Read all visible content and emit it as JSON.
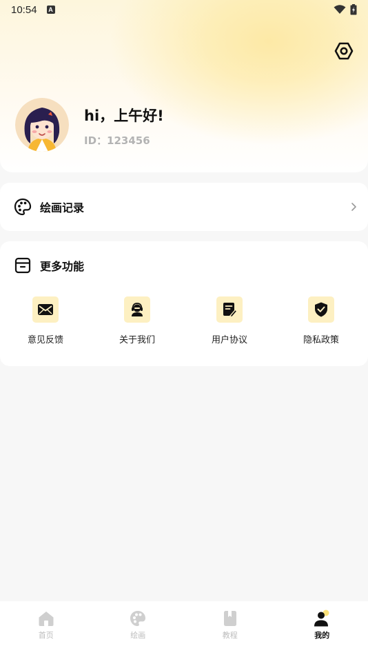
{
  "status_bar": {
    "time": "10:54",
    "notification_icon": "A",
    "icons": [
      "wifi-icon",
      "battery-icon"
    ]
  },
  "header": {
    "settings_icon": "settings-hex-icon",
    "greeting": "hi，上午好!",
    "user_id": "ID：123456"
  },
  "drawing_records": {
    "icon": "palette-icon",
    "label": "绘画记录"
  },
  "more_features": {
    "icon": "box-icon",
    "title": "更多功能",
    "items": [
      {
        "icon": "mail-icon",
        "label": "意见反馈"
      },
      {
        "icon": "support-agent-icon",
        "label": "关于我们"
      },
      {
        "icon": "document-edit-icon",
        "label": "用户协议"
      },
      {
        "icon": "shield-check-icon",
        "label": "隐私政策"
      }
    ]
  },
  "bottom_nav": {
    "items": [
      {
        "icon": "home-icon",
        "label": "首页",
        "active": false
      },
      {
        "icon": "palette-icon",
        "label": "绘画",
        "active": false
      },
      {
        "icon": "book-icon",
        "label": "教程",
        "active": false
      },
      {
        "icon": "user-icon",
        "label": "我的",
        "active": true
      }
    ]
  },
  "colors": {
    "accent_yellow": "#fdf0c2",
    "header_glow": "#fde9a6",
    "inactive_nav": "#bdbdbd",
    "background": "#f7f7f7"
  }
}
